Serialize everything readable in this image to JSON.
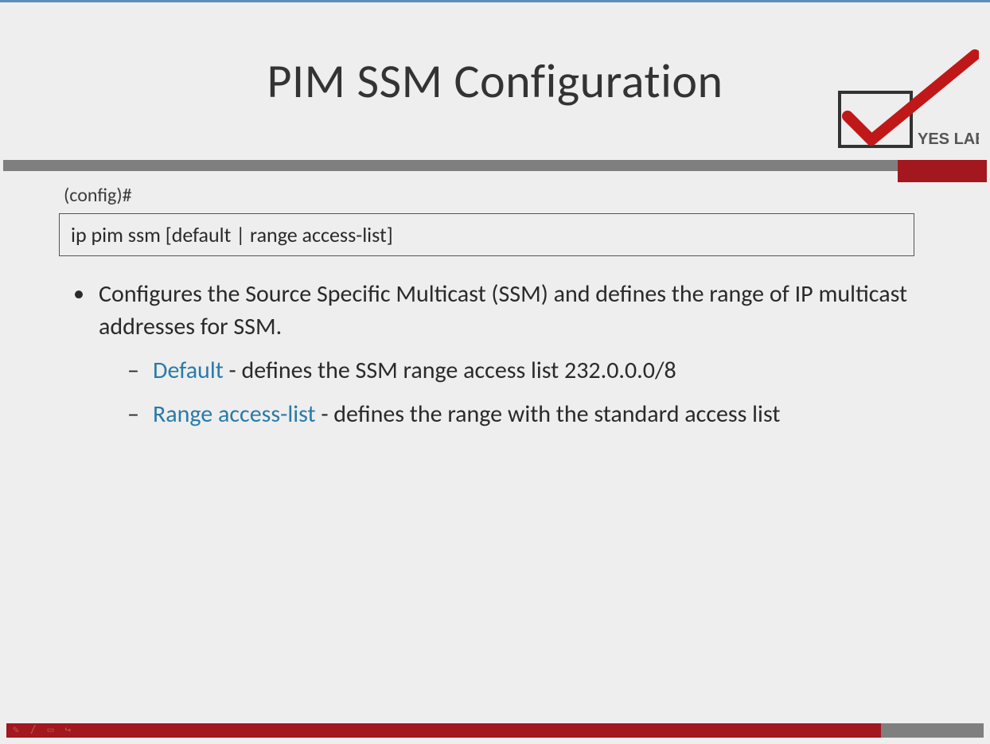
{
  "slide": {
    "title": "PIM SSM Configuration",
    "logo_text": "YES LAB",
    "config_prompt": "(config)#",
    "command": "ip pim ssm [default | range access-list]",
    "bullet": "Configures the Source Specific Multicast (SSM) and defines the range of IP multicast addresses for SSM.",
    "sub": [
      {
        "keyword": "Default",
        "text": " - defines the SSM range access list 232.0.0.0/8"
      },
      {
        "keyword": "Range access-list",
        "text": " - defines the range with the standard access list"
      }
    ]
  },
  "colors": {
    "accent_red": "#a3171e",
    "accent_gray": "#7f7f7f",
    "keyword_blue": "#2a7aa8"
  }
}
